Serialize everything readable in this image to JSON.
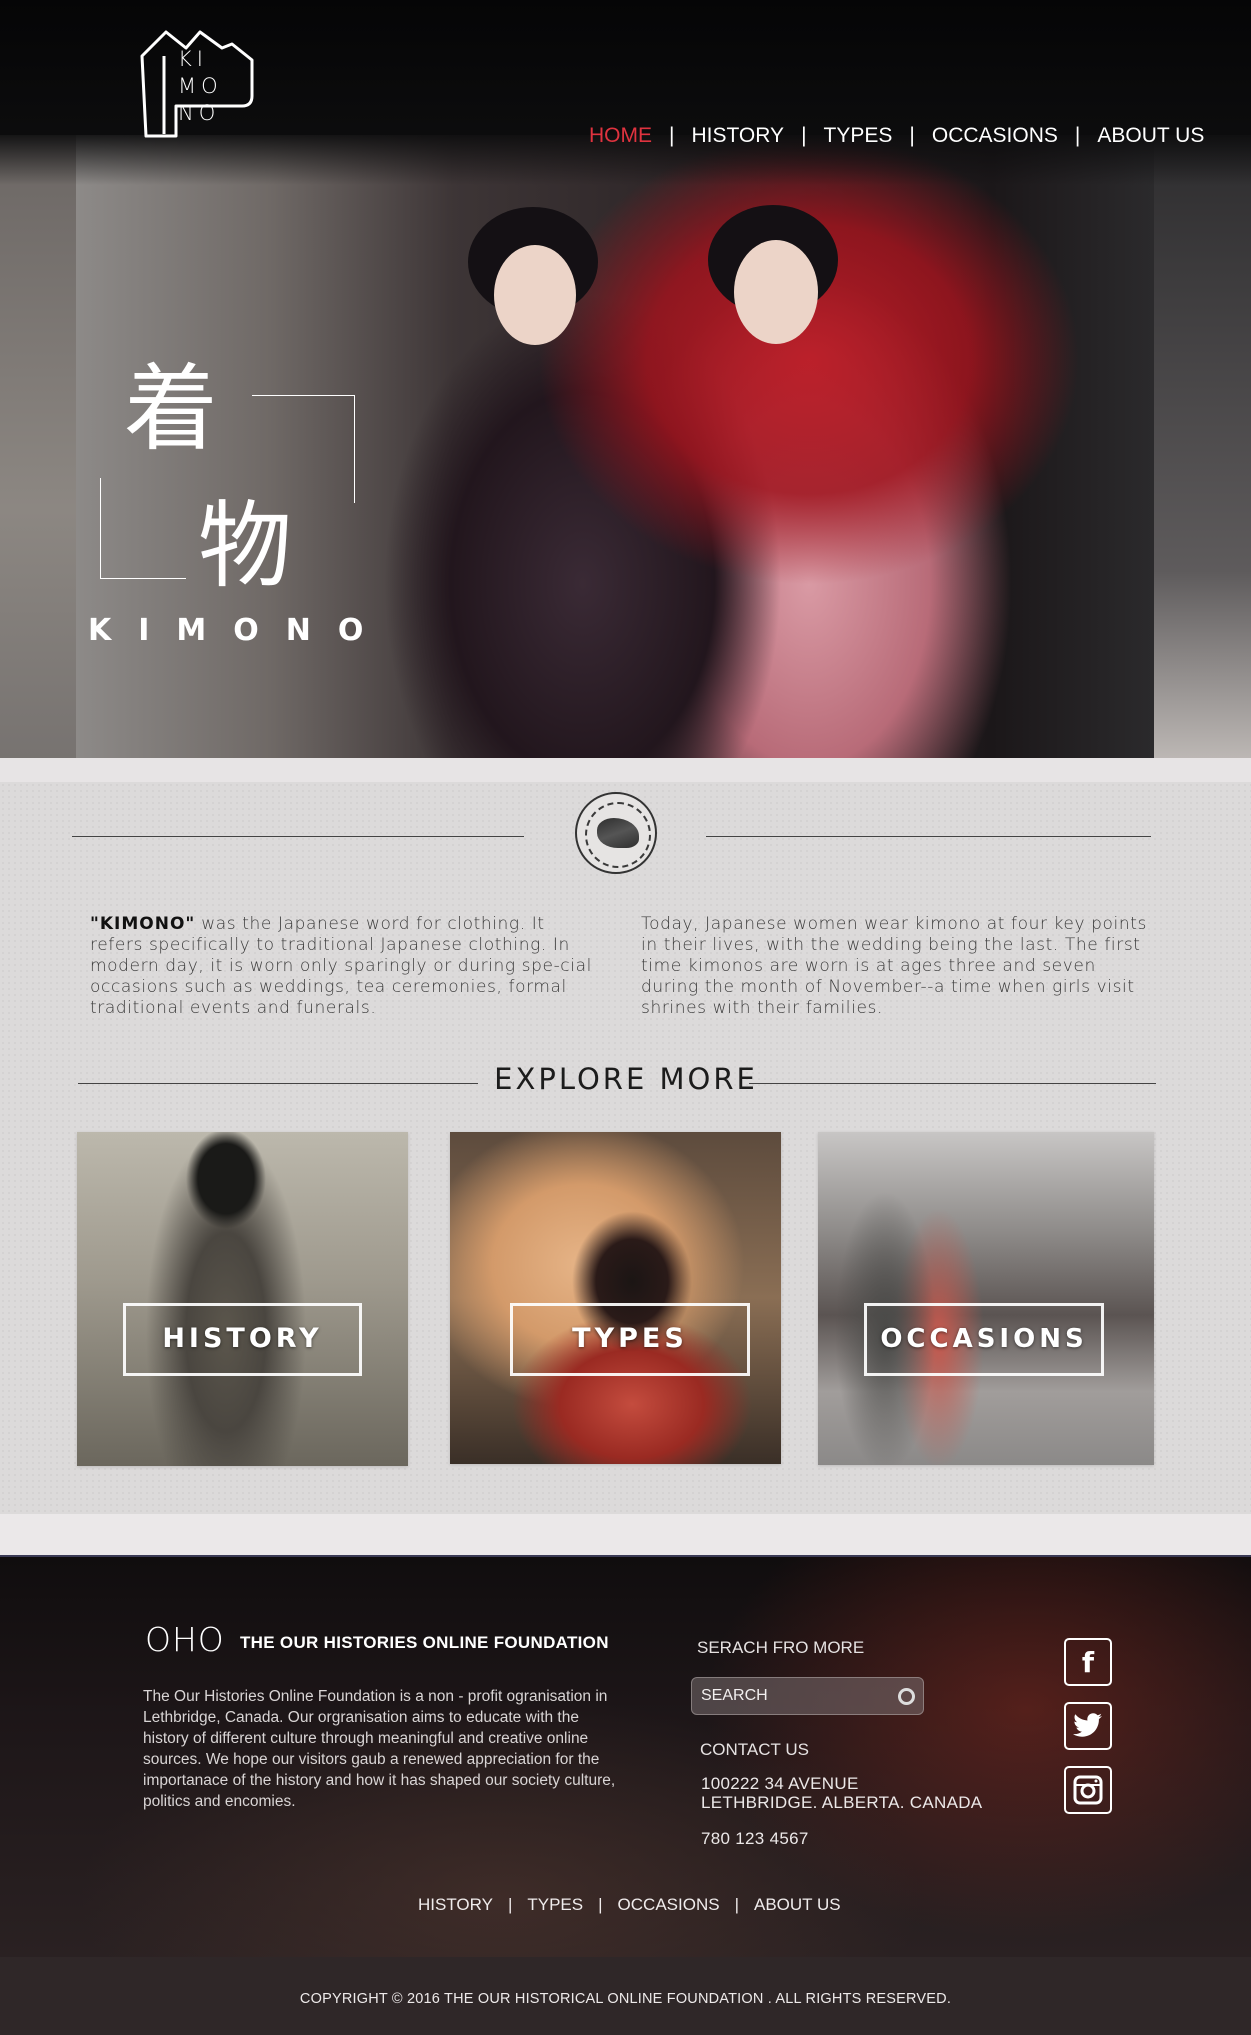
{
  "logo": {
    "lines": [
      "KI",
      "MO",
      "NO"
    ]
  },
  "nav": {
    "items": [
      {
        "label": "HOME",
        "active": true
      },
      {
        "label": "HISTORY",
        "active": false
      },
      {
        "label": "TYPES",
        "active": false
      },
      {
        "label": "OCCASIONS",
        "active": false
      },
      {
        "label": "ABOUT US",
        "active": false
      }
    ],
    "separator": "|"
  },
  "hero": {
    "kanji_1": "着",
    "kanji_2": "物",
    "word": "KIMONO"
  },
  "intro": {
    "left_keyword": "\"KIMONO\"",
    "left_text": " was the Japanese word for clothing.  It refers specifically to traditional Japanese clothing.  In modern day, it is worn only sparingly or during spe-cial occasions such as weddings, tea ceremonies, formal traditional events and funerals.",
    "right_text": "Today, Japanese women wear kimono at four key points in their lives, with the wedding being the last. The first time kimonos are worn is at ages three and seven during the month of November--a time when girls visit shrines with their families."
  },
  "explore": {
    "title": "EXPLORE MORE",
    "cards": [
      {
        "label": "HISTORY"
      },
      {
        "label": "TYPES"
      },
      {
        "label": "OCCASIONS"
      }
    ]
  },
  "footer": {
    "oho": "OHO",
    "org_name": "THE OUR HISTORIES ONLINE FOUNDATION",
    "about": "The Our Histories Online Foundation is a non - profit ogranisation in Lethbridge, Canada. Our orgranisation aims to educate with the history of different culture through meaningful and creative online sources. We hope our visitors gaub a renewed appreciation for the importanace of the history and how it has shaped our society culture, politics and encomies.",
    "search_heading": "SERACH FRO MORE",
    "search_placeholder": "SEARCH",
    "contact_heading": "CONTACT US",
    "address_line_1": "100222 34 AVENUE",
    "address_line_2": "LETHBRIDGE. ALBERTA. CANADA",
    "phone": "780 123 4567",
    "social": [
      {
        "icon": "facebook-icon",
        "glyph": "f"
      },
      {
        "icon": "twitter-icon",
        "glyph": "t"
      },
      {
        "icon": "instagram-icon",
        "glyph": "◘"
      }
    ],
    "nav": [
      "HISTORY",
      "TYPES",
      "OCCASIONS",
      "ABOUT US"
    ],
    "separator": "|",
    "copyright": "COPYRIGHT © 2016 THE OUR HISTORICAL ONLINE FOUNDATION . ALL RIGHTS RESERVED."
  },
  "colors": {
    "accent_red": "#e0333f",
    "hero_bg": "#0b0b0c",
    "section_bg": "#dcdada",
    "footer_bg": "#1d1618"
  }
}
